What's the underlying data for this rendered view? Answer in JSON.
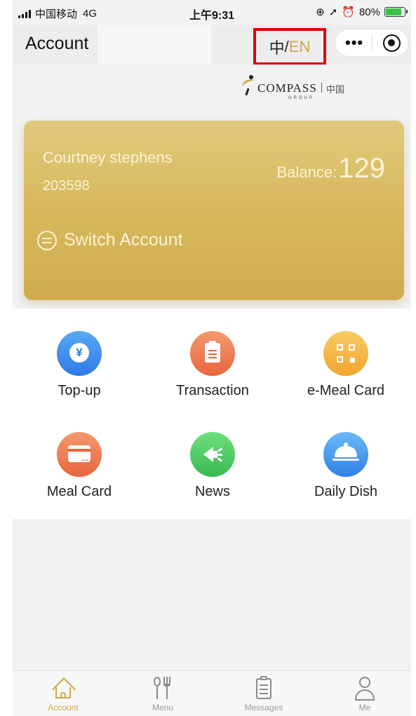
{
  "status_bar": {
    "carrier": "中国移动",
    "network": "4G",
    "time": "上午9:31",
    "battery": "80%"
  },
  "title_bar": {
    "title": "Account",
    "lang_zh": "中",
    "lang_sep": "/",
    "lang_en": "EN"
  },
  "logo": {
    "brand": "COMPASS",
    "group": "GROUP",
    "region": "中国"
  },
  "account_card": {
    "name": "Courtney stephens",
    "id": "203598",
    "balance_label": "Balance:",
    "balance_value": "129",
    "switch_label": "Switch Account"
  },
  "grid": {
    "items": [
      {
        "label": "Top-up",
        "icon": "yen-coin-icon",
        "color": "#3b86ec"
      },
      {
        "label": "Transaction",
        "icon": "clipboard-icon",
        "color": "#ea6e44"
      },
      {
        "label": "e-Meal Card",
        "icon": "qr-code-icon",
        "color": "#f3b13f"
      },
      {
        "label": "Meal Card",
        "icon": "card-icon",
        "color": "#ea6e44"
      },
      {
        "label": "News",
        "icon": "speaker-icon",
        "color": "#47c35c"
      },
      {
        "label": "Daily Dish",
        "icon": "cloche-icon",
        "color": "#3a8aec"
      }
    ]
  },
  "tab_bar": {
    "tabs": [
      {
        "label": "Account",
        "icon": "home-icon",
        "active": true
      },
      {
        "label": "Menu",
        "icon": "fork-spoon-icon",
        "active": false
      },
      {
        "label": "Messages",
        "icon": "clipboard-icon",
        "active": false
      },
      {
        "label": "Me",
        "icon": "person-icon",
        "active": false
      }
    ]
  },
  "colors": {
    "accent_gold": "#c9a84a",
    "highlight_red": "#e00000",
    "card_gold": "#d6b75a"
  }
}
